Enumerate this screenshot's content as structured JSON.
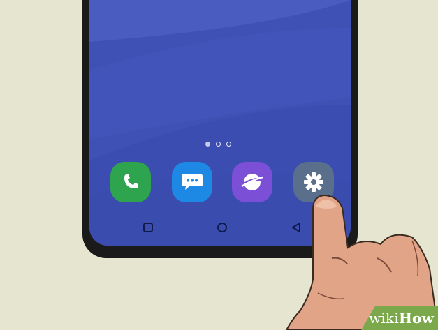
{
  "screen": {
    "page_indicator": {
      "count": 3,
      "active_index": 0
    },
    "dock": [
      {
        "id": "phone",
        "icon": "phone-icon",
        "color": "#2ea44f"
      },
      {
        "id": "messages",
        "icon": "chat-bubble-icon",
        "color": "#1e88e5"
      },
      {
        "id": "internet",
        "icon": "planet-icon",
        "color": "#7b4fd6"
      },
      {
        "id": "settings",
        "icon": "gear-icon",
        "color": "#5a6f8c"
      }
    ],
    "nav_bar": [
      "recents",
      "home",
      "back"
    ]
  },
  "watermark": {
    "part1": "wiki",
    "part2": "How"
  },
  "colors": {
    "background": "#e6e5cf",
    "screen": "#3f51b5",
    "bezel": "#1a1a1a",
    "skin": "#e2a487",
    "watermark_badge": "#7aa84a"
  }
}
